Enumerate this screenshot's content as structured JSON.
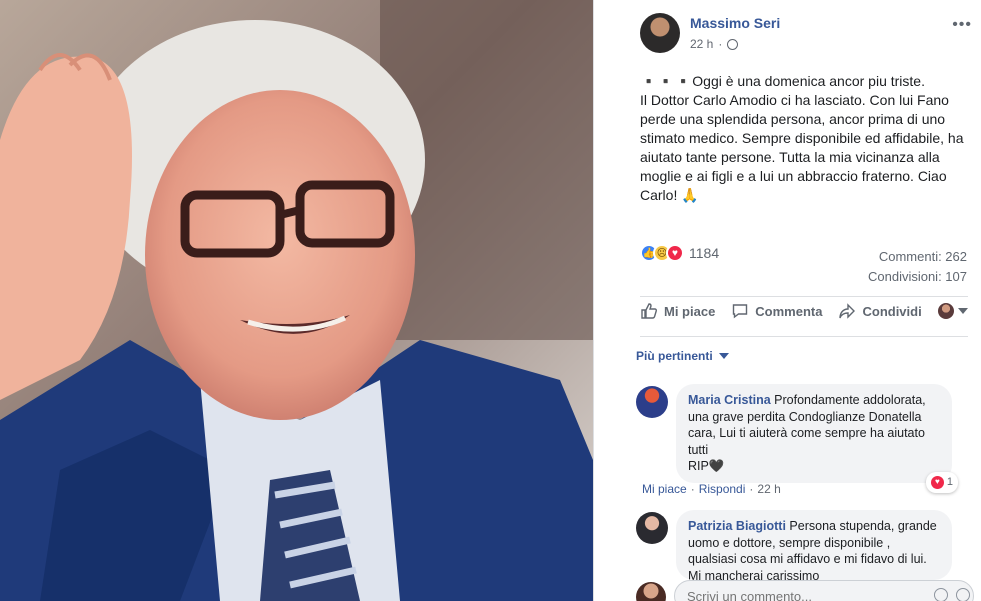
{
  "post": {
    "author": "Massimo Seri",
    "time": "22 h",
    "more_icon": "more-icon",
    "text": "▪️▪️▪️Oggi è una domenica ancor piu triste.\nIl Dottor Carlo Amodio ci ha lasciato. Con lui Fano perde una splendida persona, ancor prima di uno stimato medico. Sempre disponibile ed affidabile, ha aiutato tante persone. Tutta la mia vicinanza alla moglie e ai figli e a lui un abbraccio fraterno. Ciao Carlo! 🙏"
  },
  "stats": {
    "reaction_count": "1184",
    "comments": "Commenti: 262",
    "shares": "Condivisioni: 107",
    "reactions": [
      "like",
      "sad",
      "love"
    ]
  },
  "actions": {
    "like": "Mi piace",
    "comment": "Commenta",
    "share": "Condividi"
  },
  "filter": {
    "label": "Più pertinenti"
  },
  "comments": [
    {
      "name": "Maria Cristina",
      "text": "Profondamente addolorata, una grave perdita Condoglianze Donatella cara, Lui ti aiuterà come sempre ha aiutato tutti\nRIP🖤",
      "reaction_count": "1",
      "like": "Mi piace",
      "reply": "Rispondi",
      "time": "22 h"
    },
    {
      "name": "Patrizia Biagiotti",
      "text": "Persona stupenda, grande uomo e dottore, sempre disponibile , qualsiasi cosa mi affidavo e mi fidavo di lui. Mi mancherai carissimo"
    }
  ],
  "composer": {
    "placeholder": "Scrivi un commento..."
  },
  "colors": {
    "link": "#385898",
    "muted": "#606770",
    "bubble": "#f2f3f5"
  }
}
